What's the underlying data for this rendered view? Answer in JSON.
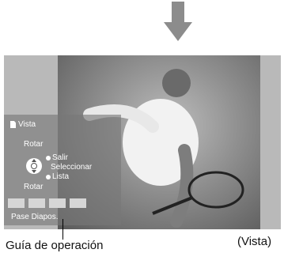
{
  "screen": {
    "title": "Vista",
    "rotate_top": "Rotar",
    "rotate_bottom": "Rotar",
    "options": {
      "exit": "Salir",
      "select": "Seleccionar",
      "list": "Lista"
    },
    "slideshow_label": "Pase Diapos.",
    "color_buttons": [
      "red",
      "green",
      "yellow",
      "blue"
    ]
  },
  "captions": {
    "guide": "Guía de operación",
    "view": "(Vista)"
  },
  "icons": {
    "title": "document-icon",
    "navigator": "dpad-icon",
    "header": "arrow-down-icon"
  },
  "colors": {
    "arrow": "#8c8c8c",
    "frame": "#b9b9b9",
    "guide_bg": "#7a7a7a",
    "text": "#ffffff"
  }
}
